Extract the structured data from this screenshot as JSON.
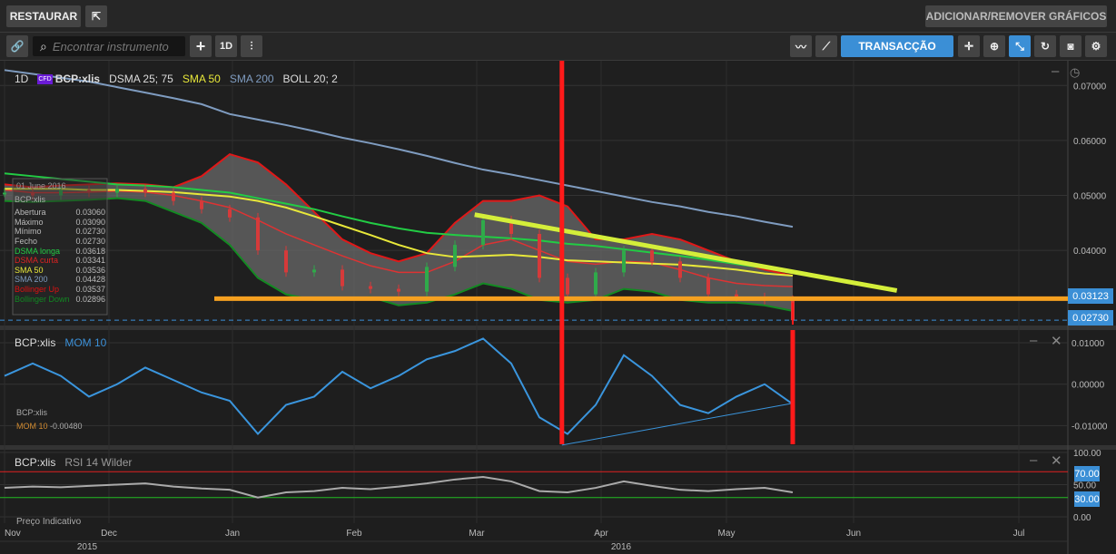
{
  "topbar": {
    "restore_label": "RESTAURAR",
    "add_remove_label": "ADICIONAR/REMOVER GRÁFICOS"
  },
  "toolbar": {
    "search_placeholder": "Encontrar instrumento",
    "period_label": "1D",
    "trade_label": "TRANSACÇÃO"
  },
  "legend": {
    "period": "1D",
    "badge": "CFD",
    "symbol": "BCP:xlis",
    "dsma": "DSMA 25; 75",
    "sma50": "SMA 50",
    "sma200": "SMA 200",
    "boll": "BOLL 20; 2"
  },
  "info": {
    "date": "01 June 2016",
    "symbol": "BCP:xlis",
    "rows": [
      {
        "label": "Abertura",
        "value": "0.03060",
        "color": "#bbbbbb"
      },
      {
        "label": "Máximo",
        "value": "0.03090",
        "color": "#bbbbbb"
      },
      {
        "label": "Mínimo",
        "value": "0.02730",
        "color": "#bbbbbb"
      },
      {
        "label": "Fecho",
        "value": "0.02730",
        "color": "#bbbbbb"
      },
      {
        "label": "DSMA longa",
        "value": "0.03618",
        "color": "#22cc44"
      },
      {
        "label": "DSMA curta",
        "value": "0.03341",
        "color": "#dd2222"
      },
      {
        "label": "SMA 50",
        "value": "0.03536",
        "color": "#e8e83a"
      },
      {
        "label": "SMA 200",
        "value": "0.04428",
        "color": "#7f9cc0"
      },
      {
        "label": "Bollinger Up",
        "value": "0.03537",
        "color": "#dd1111"
      },
      {
        "label": "Bollinger Down",
        "value": "0.02896",
        "color": "#118822"
      }
    ]
  },
  "mom_pane": {
    "symbol": "BCP:xlis",
    "title": "MOM 10",
    "info_symbol": "BCP:xlis",
    "info_label": "MOM 10",
    "info_value": "-0.00480"
  },
  "rsi_pane": {
    "symbol": "BCP:xlis",
    "title": "RSI 14 Wilder"
  },
  "footer": {
    "price_note": "Preço Indicativo",
    "months": [
      "Nov",
      "Dec",
      "Jan",
      "Feb",
      "Mar",
      "Apr",
      "May",
      "Jun",
      "Jul"
    ],
    "years": [
      "2015",
      "2016"
    ]
  },
  "axis": {
    "price_ticks": [
      "0.07000",
      "0.06000",
      "0.05000",
      "0.04000"
    ],
    "price_tags": [
      "0.03123",
      "0.02730"
    ],
    "mom_ticks": [
      "0.01000",
      "0.00000",
      "-0.01000"
    ],
    "rsi_ticks": [
      "100.00",
      "50.00",
      "0.00"
    ],
    "rsi_tags": [
      "70.00",
      "30.00"
    ]
  },
  "colors": {
    "accent": "#3b8fd6",
    "up": "#2faa4a",
    "down": "#d63a3a"
  },
  "chart_data": {
    "type": "line",
    "sampling": "weekly",
    "price": {
      "ylim": [
        0.0265,
        0.0745
      ],
      "close": [
        0.0505,
        0.05,
        0.051,
        0.0505,
        0.0512,
        0.0505,
        0.049,
        0.0475,
        0.046,
        0.04,
        0.036,
        0.0365,
        0.0335,
        0.033,
        0.0325,
        0.037,
        0.041,
        0.0455,
        0.043,
        0.035,
        0.032,
        0.036,
        0.04,
        0.038,
        0.035,
        0.032,
        0.0315,
        0.031,
        0.0273
      ],
      "sma200": [
        0.0728,
        0.0721,
        0.0714,
        0.0707,
        0.0697,
        0.0687,
        0.0677,
        0.0666,
        0.0648,
        0.0638,
        0.0628,
        0.0617,
        0.0605,
        0.0595,
        0.0584,
        0.0572,
        0.0559,
        0.0547,
        0.0538,
        0.0528,
        0.0518,
        0.0508,
        0.0498,
        0.0488,
        0.048,
        0.047,
        0.0462,
        0.0452,
        0.0443
      ],
      "sma50": [
        0.0512,
        0.0512,
        0.0512,
        0.051,
        0.051,
        0.0508,
        0.0506,
        0.0502,
        0.0498,
        0.049,
        0.0478,
        0.0462,
        0.0445,
        0.0428,
        0.041,
        0.0395,
        0.0388,
        0.039,
        0.0392,
        0.0388,
        0.0382,
        0.038,
        0.0378,
        0.0376,
        0.0374,
        0.037,
        0.0365,
        0.0358,
        0.0354
      ],
      "dsma_long": [
        0.054,
        0.0535,
        0.053,
        0.0525,
        0.052,
        0.0518,
        0.0515,
        0.051,
        0.0505,
        0.0495,
        0.0485,
        0.0475,
        0.0462,
        0.045,
        0.044,
        0.0432,
        0.0428,
        0.0425,
        0.0422,
        0.0418,
        0.0412,
        0.0408,
        0.0402,
        0.0396,
        0.039,
        0.0383,
        0.0375,
        0.0368,
        0.0362
      ],
      "dsma_short": [
        0.051,
        0.0505,
        0.0505,
        0.0506,
        0.0508,
        0.0506,
        0.05,
        0.049,
        0.0478,
        0.0455,
        0.043,
        0.041,
        0.039,
        0.0372,
        0.036,
        0.036,
        0.038,
        0.041,
        0.042,
        0.04,
        0.038,
        0.0375,
        0.038,
        0.0378,
        0.0365,
        0.035,
        0.034,
        0.0336,
        0.0334
      ],
      "boll_up": [
        0.052,
        0.0515,
        0.0518,
        0.052,
        0.0522,
        0.052,
        0.0515,
        0.0535,
        0.0575,
        0.056,
        0.052,
        0.047,
        0.042,
        0.0395,
        0.038,
        0.0395,
        0.045,
        0.049,
        0.049,
        0.05,
        0.048,
        0.042,
        0.042,
        0.043,
        0.042,
        0.04,
        0.038,
        0.0365,
        0.0354
      ],
      "boll_down": [
        0.049,
        0.0488,
        0.049,
        0.0492,
        0.0495,
        0.049,
        0.047,
        0.045,
        0.041,
        0.035,
        0.032,
        0.031,
        0.031,
        0.0315,
        0.03,
        0.0305,
        0.032,
        0.034,
        0.033,
        0.031,
        0.0305,
        0.031,
        0.033,
        0.0325,
        0.031,
        0.0305,
        0.0305,
        0.03,
        0.029
      ],
      "trendline": {
        "from": [
          16.7,
          0.0465
        ],
        "to": [
          31.7,
          0.0327
        ]
      },
      "support": 0.03123,
      "last": 0.0273
    },
    "mom": {
      "ylim": [
        -0.0145,
        0.0135
      ],
      "values": [
        0.002,
        0.005,
        0.002,
        -0.003,
        0.0,
        0.004,
        0.001,
        -0.002,
        -0.004,
        -0.012,
        -0.005,
        -0.003,
        0.003,
        -0.001,
        0.002,
        0.006,
        0.008,
        0.011,
        0.005,
        -0.008,
        -0.012,
        -0.005,
        0.007,
        0.002,
        -0.005,
        -0.007,
        -0.003,
        0.0,
        -0.0048
      ],
      "trendline": {
        "from": [
          19.8,
          -0.0147
        ],
        "to": [
          28,
          -0.0046
        ]
      }
    },
    "rsi": {
      "ylim": [
        0,
        100
      ],
      "levels": [
        70,
        30
      ],
      "values": [
        45,
        47,
        46,
        48,
        50,
        52,
        47,
        44,
        42,
        30,
        38,
        40,
        45,
        43,
        47,
        52,
        58,
        62,
        55,
        40,
        38,
        45,
        55,
        48,
        42,
        40,
        43,
        45,
        38
      ]
    },
    "markers": {
      "vertical_lines_at_index": [
        19.8,
        28
      ]
    }
  }
}
